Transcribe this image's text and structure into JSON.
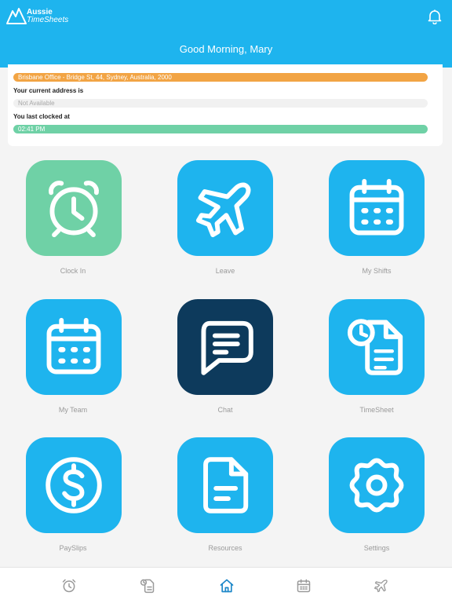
{
  "header": {
    "logo_line1": "Aussie",
    "logo_line2": "TimeSheets",
    "greeting": "Good Morning, Mary",
    "bg_color": "#1eb4ee"
  },
  "info_card": {
    "office_value": "Brisbane Office - Bridge St, 44, Sydney, Australia, 2000",
    "address_label": "Your current address is",
    "address_value": "Not Available",
    "clock_label": "You last clocked at",
    "clock_value": "02:41 PM"
  },
  "tiles": [
    {
      "id": "clock-in",
      "label": "Clock In",
      "icon": "alarm-clock-icon",
      "color": "#6fd1a6"
    },
    {
      "id": "leave",
      "label": "Leave",
      "icon": "airplane-icon",
      "color": "#1eb4ee"
    },
    {
      "id": "my-shifts",
      "label": "My Shifts",
      "icon": "calendar-icon",
      "color": "#1eb4ee"
    },
    {
      "id": "my-team",
      "label": "My Team",
      "icon": "calendar-icon",
      "color": "#1eb4ee"
    },
    {
      "id": "chat",
      "label": "Chat",
      "icon": "chat-bubble-icon",
      "color": "#0d3a5c"
    },
    {
      "id": "timesheet",
      "label": "TimeSheet",
      "icon": "timesheet-document-icon",
      "color": "#1eb4ee"
    },
    {
      "id": "payslips",
      "label": "PaySlips",
      "icon": "dollar-coin-icon",
      "color": "#1eb4ee"
    },
    {
      "id": "resources",
      "label": "Resources",
      "icon": "document-icon",
      "color": "#1eb4ee"
    },
    {
      "id": "settings",
      "label": "Settings",
      "icon": "gear-icon",
      "color": "#1eb4ee"
    }
  ],
  "tabbar": {
    "active_color": "#1e88c9",
    "inactive_color": "#9a9a9a",
    "tabs": [
      {
        "icon": "alarm-clock-icon",
        "active": false
      },
      {
        "icon": "timesheet-document-icon",
        "active": false
      },
      {
        "icon": "home-icon",
        "active": true
      },
      {
        "icon": "calendar-icon",
        "active": false
      },
      {
        "icon": "airplane-icon",
        "active": false
      }
    ]
  }
}
